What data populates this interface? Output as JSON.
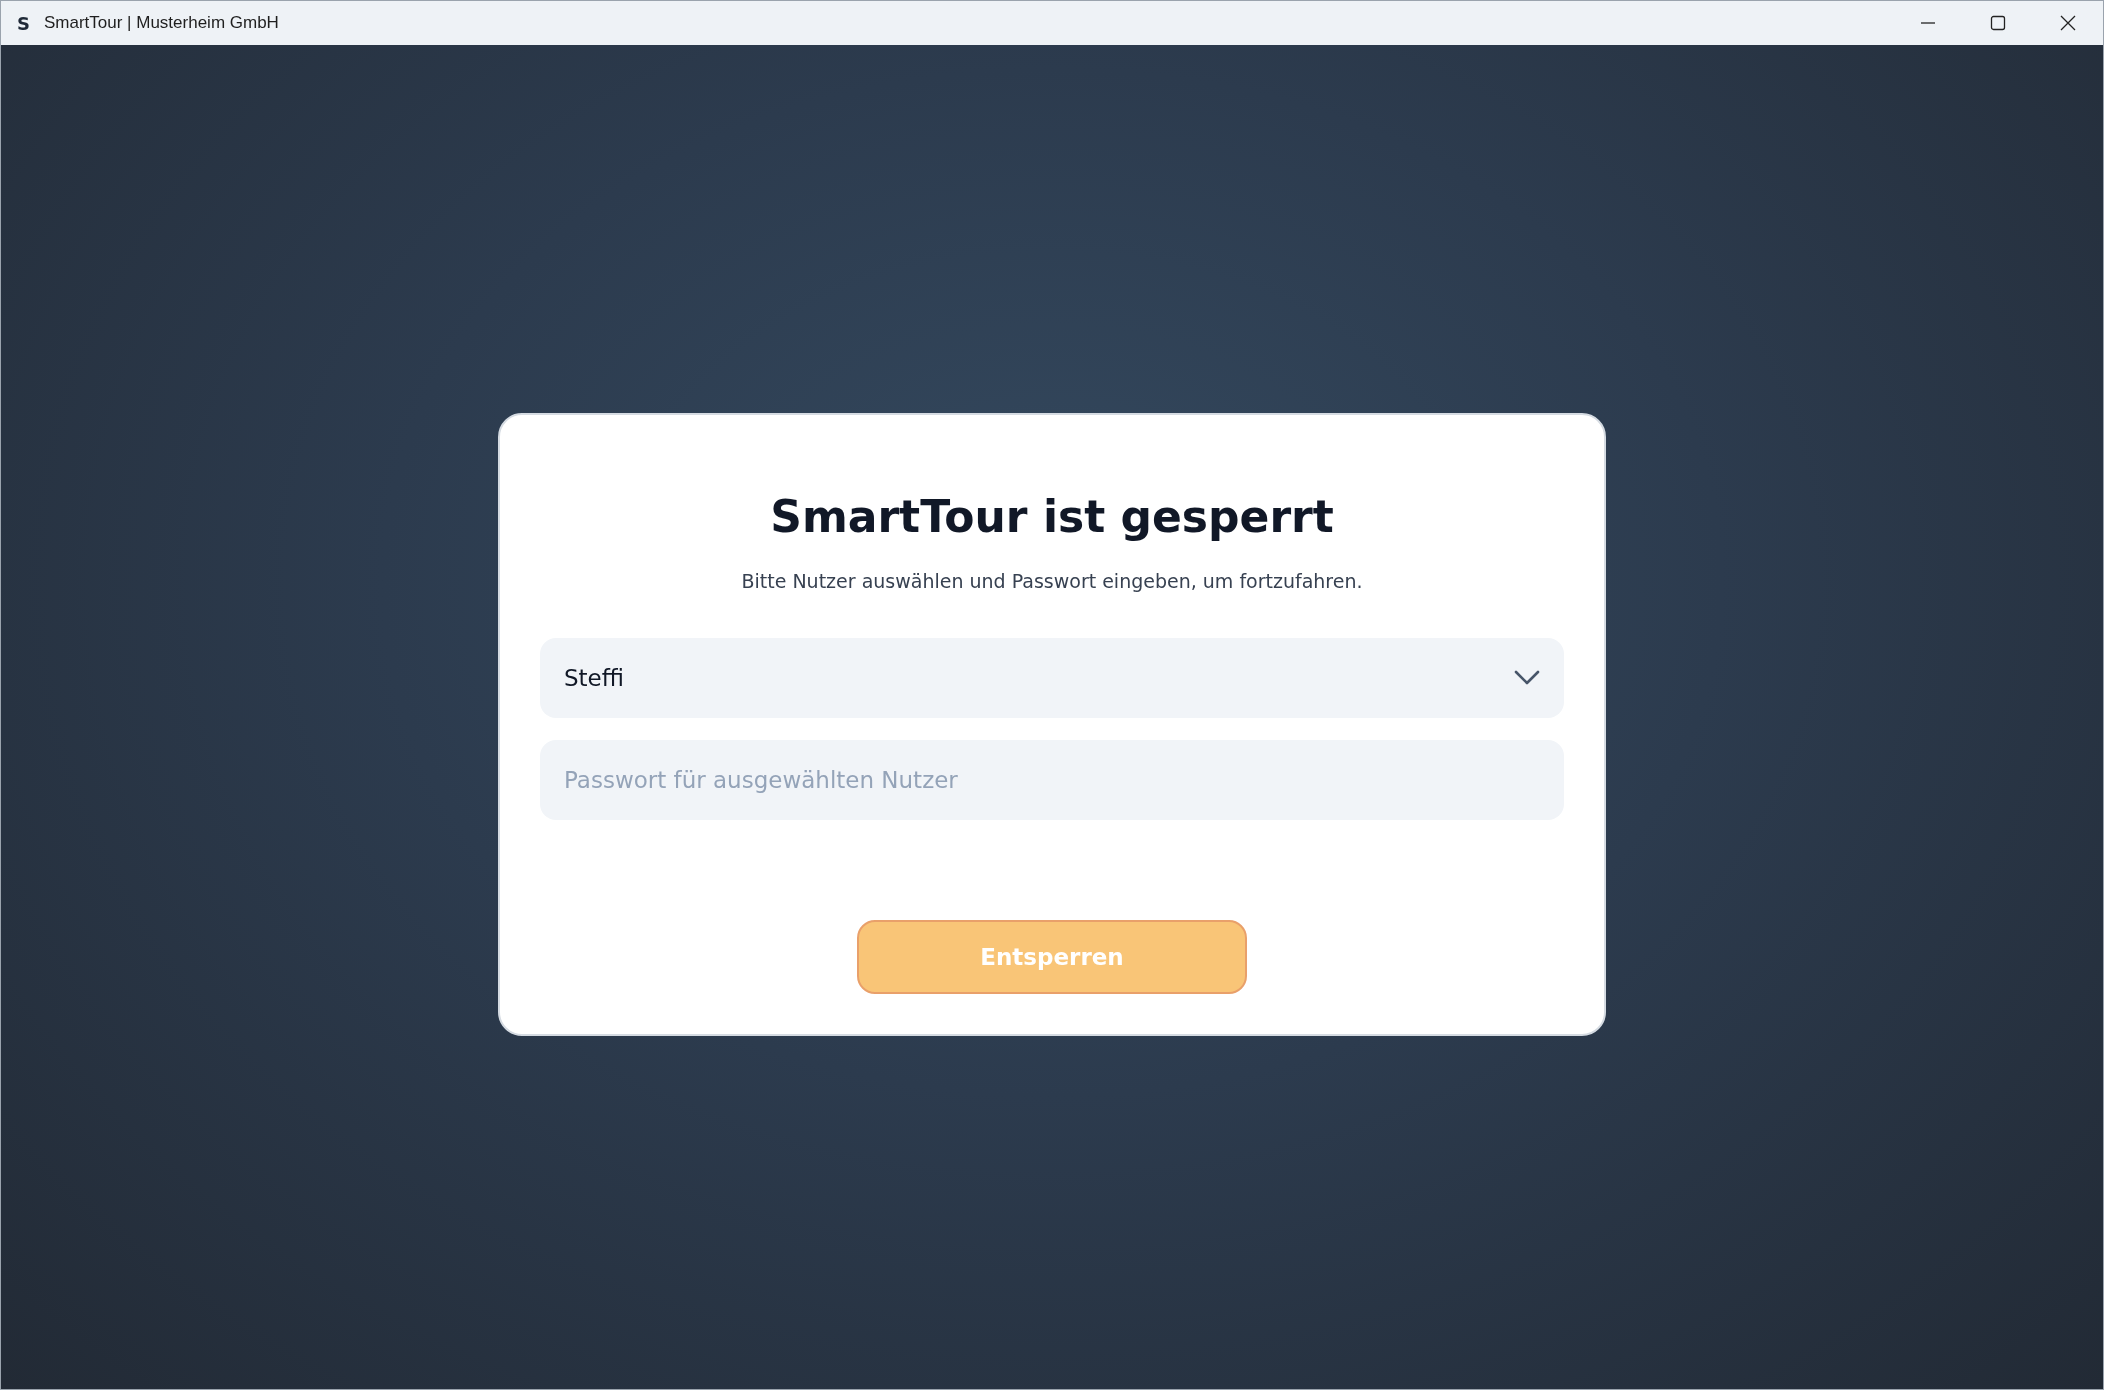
{
  "window": {
    "logo": "S",
    "title": "SmartTour | Musterheim GmbH"
  },
  "lock_card": {
    "title": "SmartTour ist gesperrt",
    "subtitle": "Bitte Nutzer auswählen und Passwort eingeben, um fortzufahren.",
    "user_select": {
      "value": "Steffi"
    },
    "password_field": {
      "placeholder": "Passwort für ausgewählten Nutzer"
    },
    "unlock_button": {
      "label": "Entsperren",
      "disabled": true
    }
  }
}
